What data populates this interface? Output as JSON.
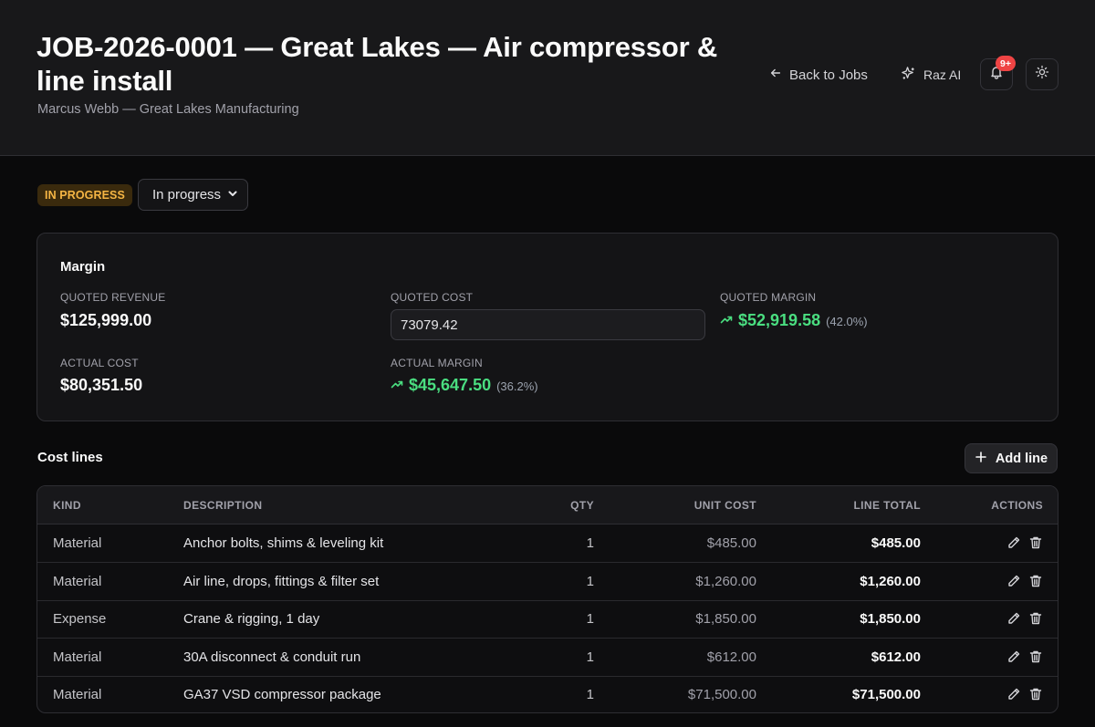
{
  "header": {
    "title": "JOB-2026-0001 — Great Lakes — Air compressor & line install",
    "subtitle": "Marcus Webb — Great Lakes Manufacturing",
    "back_label": "Back to Jobs",
    "ai_label": "Raz AI",
    "notification_count": "9+"
  },
  "status": {
    "badge": "IN PROGRESS",
    "selected": "In progress"
  },
  "margin": {
    "title": "Margin",
    "quoted_revenue_label": "QUOTED REVENUE",
    "quoted_revenue": "$125,999.00",
    "quoted_cost_label": "QUOTED COST",
    "quoted_cost": "73079.42",
    "quoted_margin_label": "QUOTED MARGIN",
    "quoted_margin": "$52,919.58",
    "quoted_margin_pct": "(42.0%)",
    "actual_cost_label": "ACTUAL COST",
    "actual_cost": "$80,351.50",
    "actual_margin_label": "ACTUAL MARGIN",
    "actual_margin": "$45,647.50",
    "actual_margin_pct": "(36.2%)"
  },
  "cost_lines": {
    "title": "Cost lines",
    "add_label": "Add line",
    "columns": {
      "kind": "KIND",
      "description": "DESCRIPTION",
      "qty": "QTY",
      "unit_cost": "UNIT COST",
      "line_total": "LINE TOTAL",
      "actions": "ACTIONS"
    },
    "rows": [
      {
        "kind": "Material",
        "description": "Anchor bolts, shims & leveling kit",
        "qty": "1",
        "unit_cost": "$485.00",
        "line_total": "$485.00"
      },
      {
        "kind": "Material",
        "description": "Air line, drops, fittings & filter set",
        "qty": "1",
        "unit_cost": "$1,260.00",
        "line_total": "$1,260.00"
      },
      {
        "kind": "Expense",
        "description": "Crane & rigging, 1 day",
        "qty": "1",
        "unit_cost": "$1,850.00",
        "line_total": "$1,850.00"
      },
      {
        "kind": "Material",
        "description": "30A disconnect & conduit run",
        "qty": "1",
        "unit_cost": "$612.00",
        "line_total": "$612.00"
      },
      {
        "kind": "Material",
        "description": "GA37 VSD compressor package",
        "qty": "1",
        "unit_cost": "$71,500.00",
        "line_total": "$71,500.00"
      }
    ]
  },
  "colors": {
    "accent_green": "#4ade80",
    "status_amber": "#f5b544",
    "badge_red": "#ef4444"
  },
  "icons": [
    "arrow-left-icon",
    "sparkles-icon",
    "bell-icon",
    "sun-icon",
    "chevron-down-icon",
    "trending-up-icon",
    "plus-icon",
    "pencil-icon",
    "trash-icon"
  ]
}
